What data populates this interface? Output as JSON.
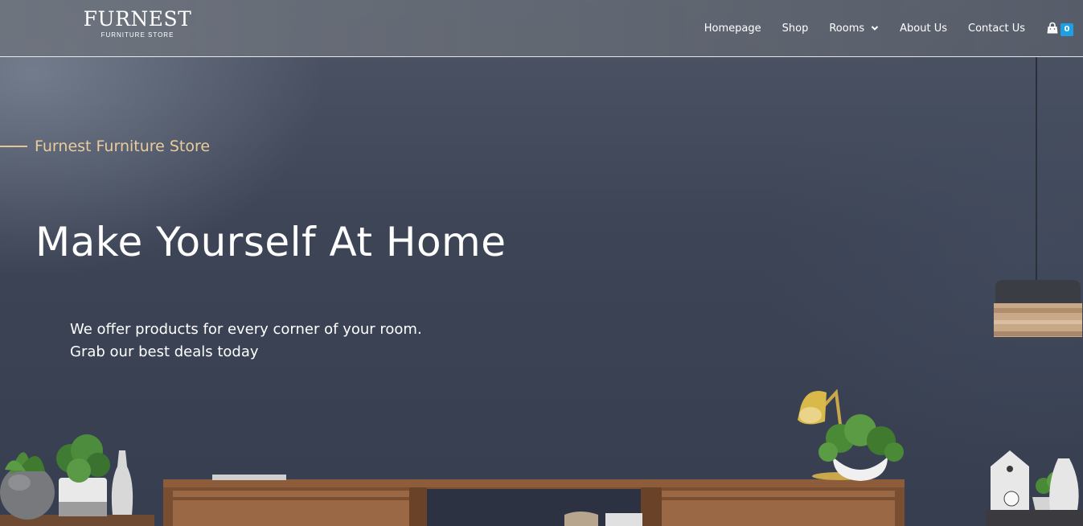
{
  "brand": {
    "name": "FURNEST",
    "tagline": "FURNITURE STORE"
  },
  "nav": {
    "items": [
      {
        "label": "Homepage"
      },
      {
        "label": "Shop"
      },
      {
        "label": "Rooms"
      },
      {
        "label": "About Us"
      },
      {
        "label": "Contact Us"
      }
    ],
    "cart_count": "0"
  },
  "hero": {
    "kicker": "Furnest Furniture Store",
    "title": "Make Yourself At Home",
    "copy_line1": "We offer products for every corner of your room.",
    "copy_line2": "Grab our best deals today"
  },
  "colors": {
    "accent_gold": "#eacb9c",
    "badge_blue": "#1f9fe3",
    "wall": "#3c4456"
  },
  "icons": [
    "chevron-down-icon",
    "shopping-bag-icon"
  ]
}
